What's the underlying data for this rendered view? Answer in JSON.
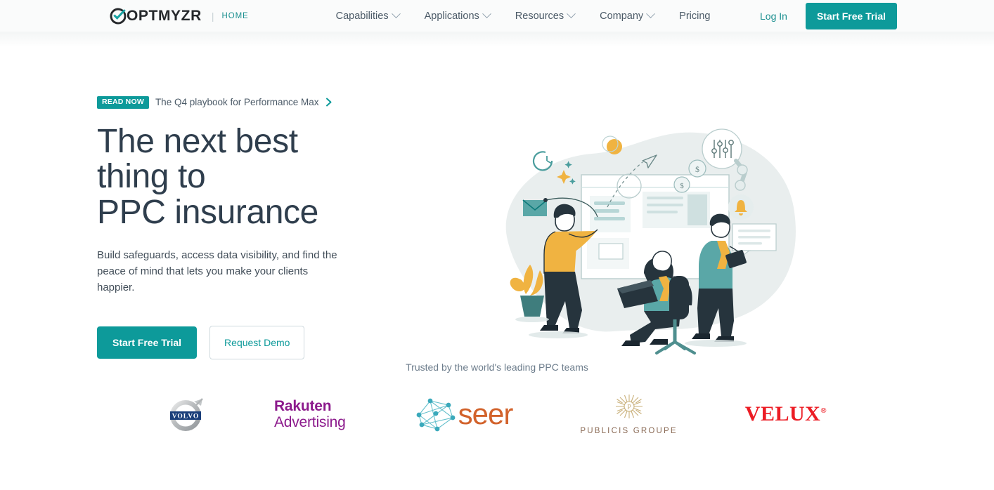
{
  "brand": {
    "name": "OPTMYZR",
    "logo_icon": "optmyzr-check-circle-icon",
    "separator": "|",
    "home_label": "HOME"
  },
  "theme": {
    "teal": "#0d9a9a",
    "teal_link": "#1a8f8f",
    "headline": "#2f3e4d",
    "body_text": "#414d58",
    "nav_text": "#4b5a67",
    "muted": "#6d7d8c",
    "header_bg": "#fafbfb"
  },
  "nav": {
    "items": [
      {
        "label": "Capabilities",
        "has_dropdown": true,
        "icon": "chevron-down-icon"
      },
      {
        "label": "Applications",
        "has_dropdown": true,
        "icon": "chevron-down-icon"
      },
      {
        "label": "Resources",
        "has_dropdown": true,
        "icon": "chevron-down-icon"
      },
      {
        "label": "Company",
        "has_dropdown": true,
        "icon": "chevron-down-icon"
      },
      {
        "label": "Pricing",
        "has_dropdown": false,
        "icon": ""
      }
    ],
    "login_label": "Log In",
    "cta_label": "Start Free Trial"
  },
  "hero": {
    "promo": {
      "badge": "READ NOW",
      "text": "The Q4 playbook for Performance Max",
      "arrow_icon": "chevron-right-icon"
    },
    "title_line1": "The next best",
    "title_line2": "thing to",
    "title_line3": "PPC insurance",
    "subtitle": "Build safeguards, access data visibility, and find the peace of mind that lets you make your clients happier.",
    "primary_cta": "Start Free Trial",
    "secondary_cta": "Request Demo",
    "illustration_name": "team-analytics-dashboard-illustration"
  },
  "trust": {
    "label": "Trusted by the world's leading PPC teams",
    "logos": [
      {
        "name": "volvo",
        "text": "VOLVO",
        "color": "#1b3f7a"
      },
      {
        "name": "rakuten-advertising",
        "line1": "Rakuten",
        "line2": "Advertising",
        "color": "#8c1a8c"
      },
      {
        "name": "seer",
        "text": "seer",
        "color": "#d2622b"
      },
      {
        "name": "publicis-groupe",
        "text": "PUBLICIS GROUPE",
        "color": "#8a6a55"
      },
      {
        "name": "velux",
        "text": "VELUX",
        "registered": "®",
        "color": "#ec1c24"
      }
    ]
  }
}
